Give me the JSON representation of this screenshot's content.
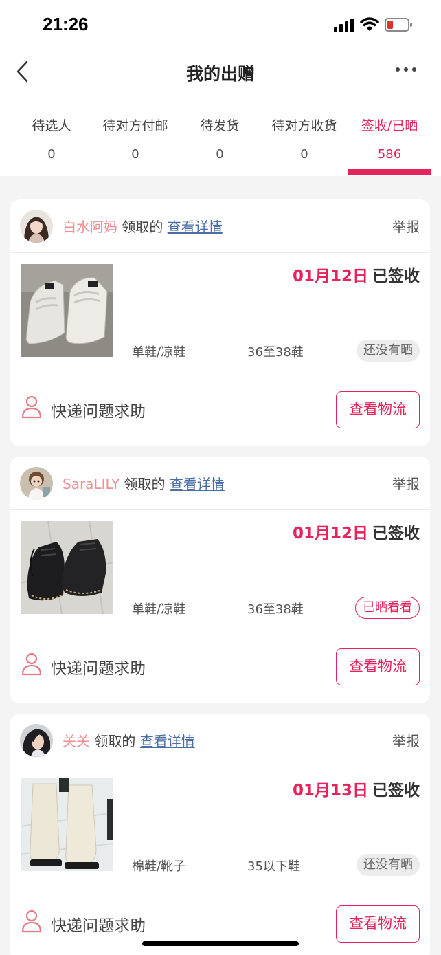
{
  "status_bar": {
    "time": "21:26"
  },
  "nav": {
    "title": "我的出赠"
  },
  "tabs": [
    {
      "label": "待选人",
      "count": "0"
    },
    {
      "label": "待对方付邮",
      "count": "0"
    },
    {
      "label": "待发货",
      "count": "0"
    },
    {
      "label": "待对方收货",
      "count": "0"
    },
    {
      "label": "签收/已晒",
      "count": "586"
    }
  ],
  "orders": [
    {
      "username": "白水阿妈",
      "claimed_text": "领取的",
      "detail_link": "查看详情",
      "report": "举报",
      "date": "01月12日",
      "status": "已签收",
      "category": "单鞋/凉鞋",
      "size": "36至38鞋",
      "badge": "还没有晒",
      "help": "快递问题求助",
      "logistics": "查看物流"
    },
    {
      "username": "SaraLILY",
      "claimed_text": "领取的",
      "detail_link": "查看详情",
      "report": "举报",
      "date": "01月12日",
      "status": "已签收",
      "category": "单鞋/凉鞋",
      "size": "36至38鞋",
      "badge": "已晒看看",
      "help": "快递问题求助",
      "logistics": "查看物流"
    },
    {
      "username": "关关",
      "claimed_text": "领取的",
      "detail_link": "查看详情",
      "report": "举报",
      "date": "01月13日",
      "status": "已签收",
      "category": "棉鞋/靴子",
      "size": "35以下鞋",
      "badge": "还没有晒",
      "help": "快递问题求助",
      "logistics": "查看物流"
    }
  ],
  "colors": {
    "accent": "#e5245b",
    "username": "#ef8f94",
    "link": "#4a6ea5"
  }
}
